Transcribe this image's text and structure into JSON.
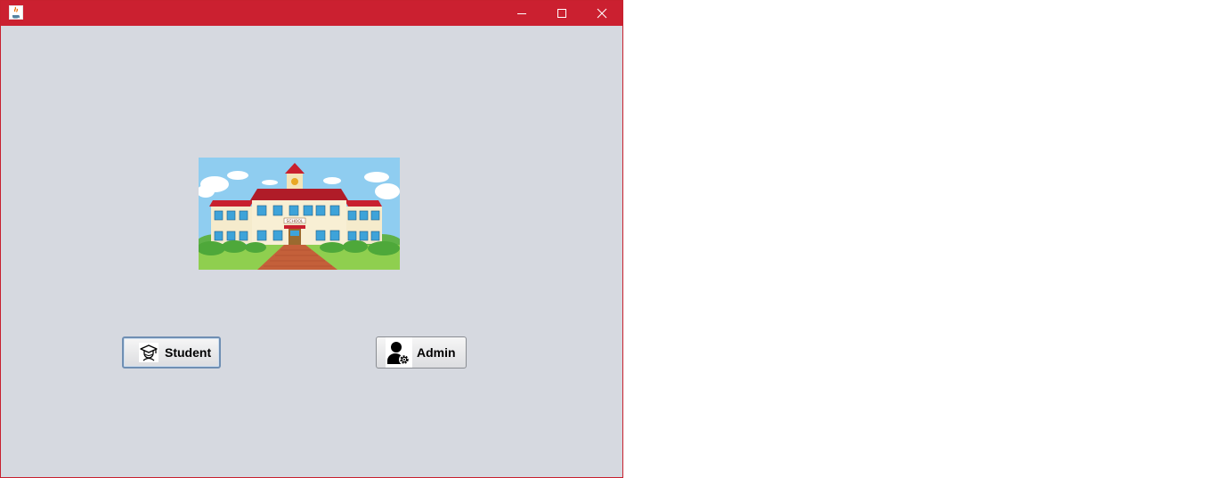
{
  "window": {
    "title_bar_color": "#cb2030",
    "background_color": "#d6d9e0",
    "controls": {
      "minimize_icon": "minimize-icon",
      "maximize_icon": "maximize-icon",
      "close_icon": "close-icon"
    }
  },
  "main": {
    "image": {
      "icon": "school-building-image",
      "sign_text": "SCHOOL"
    },
    "buttons": {
      "student_label": "Student",
      "student_icon": "graduate-icon",
      "admin_label": "Admin",
      "admin_icon": "admin-user-gear-icon"
    }
  }
}
